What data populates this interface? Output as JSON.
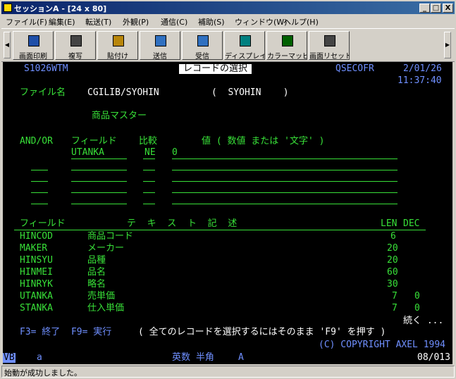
{
  "window": {
    "title": "セッションA - [24 x 80]",
    "min": "_",
    "max": "□",
    "close": "X"
  },
  "menu": [
    "ファイル(F)",
    "編集(E)",
    "転送(T)",
    "外観(P)",
    "通信(C)",
    "補助(S)",
    "ウィンドウ(W)",
    "ヘルプ(H)"
  ],
  "toolbar": {
    "buttons": [
      "画面印刷",
      "複写",
      "貼付け",
      "送信",
      "受信",
      "ディスプレイ",
      "カラーマッピング",
      "画面リセット"
    ],
    "colors": [
      "#1f4fa8",
      "#444444",
      "#b8860b",
      "#3070c0",
      "#3070c0",
      "#008080",
      "#006000",
      "#444444"
    ]
  },
  "screen": {
    "program_id": "S1026WTM",
    "screen_title": "レコードの選択",
    "user": "QSECOFR",
    "date": "2/01/26",
    "time": "11:37:40",
    "file_label": "ファイル名",
    "file_value": "CGILIB/SYOHIN",
    "record_format": "(  SYOHIN    )",
    "file_text": "商品マスター",
    "hdr_andor": "AND/OR",
    "hdr_field": "フィールド",
    "hdr_compare": "比較",
    "hdr_value": "値 ( 数値 または '文字' )",
    "row1_field": "UTANKA",
    "row1_op": "NE",
    "row1_value": "0",
    "list_hdr_field": "フィールド",
    "list_hdr_text": "テ  キ  ス  ト  記  述",
    "list_hdr_len": "LEN",
    "list_hdr_dec": "DEC",
    "fields": [
      {
        "name": "HINCOD",
        "text": "商品コード",
        "len": "6",
        "dec": ""
      },
      {
        "name": "MAKER",
        "text": "メーカー",
        "len": "20",
        "dec": ""
      },
      {
        "name": "HINSYU",
        "text": "品種",
        "len": "20",
        "dec": ""
      },
      {
        "name": "HINMEI",
        "text": "品名",
        "len": "60",
        "dec": ""
      },
      {
        "name": "HINRYK",
        "text": "略名",
        "len": "30",
        "dec": ""
      },
      {
        "name": "UTANKA",
        "text": "売単価",
        "len": "7",
        "dec": "0"
      },
      {
        "name": "STANKA",
        "text": "仕入単価",
        "len": "7",
        "dec": "0"
      }
    ],
    "more": "続く ...",
    "fkeys": "F3= 終了  F9= 実行",
    "hint": "( 全てのレコードを選択するにはそのまま 'F9' を押す )",
    "copyright": "(C) COPYRIGHT AXEL 1994"
  },
  "oia": {
    "vb": "VB",
    "mode": "a",
    "input_mode": "英数 半角",
    "attr": "A",
    "cursor": "08/013"
  },
  "status": {
    "message": "始動が成功しました。"
  }
}
